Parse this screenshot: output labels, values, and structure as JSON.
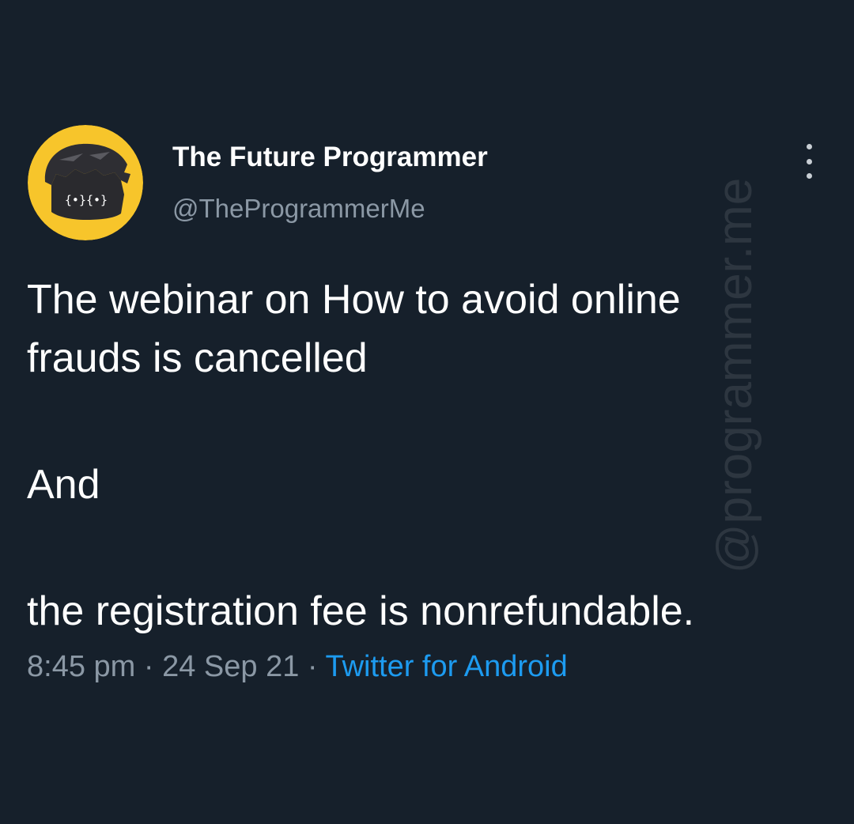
{
  "tweet": {
    "author": {
      "display_name": "The Future Programmer",
      "handle": "@TheProgrammerMe",
      "avatar_icon": "programmer-face-logo",
      "avatar_text": "{•}{•}"
    },
    "more_icon": "vertical-ellipsis-icon",
    "text_lines": [
      "The webinar on How to avoid online",
      "frauds is cancelled",
      "And",
      "the registration fee is nonrefundable."
    ],
    "time": "8:45 pm",
    "date": "24 Sep 21",
    "separator": "·",
    "source": "Twitter for Android"
  },
  "watermark": "@programmer.me",
  "colors": {
    "background": "#16202b",
    "secondary_text": "#8b98a5",
    "link": "#1d9bf0",
    "avatar_bg": "#f7c52b"
  }
}
